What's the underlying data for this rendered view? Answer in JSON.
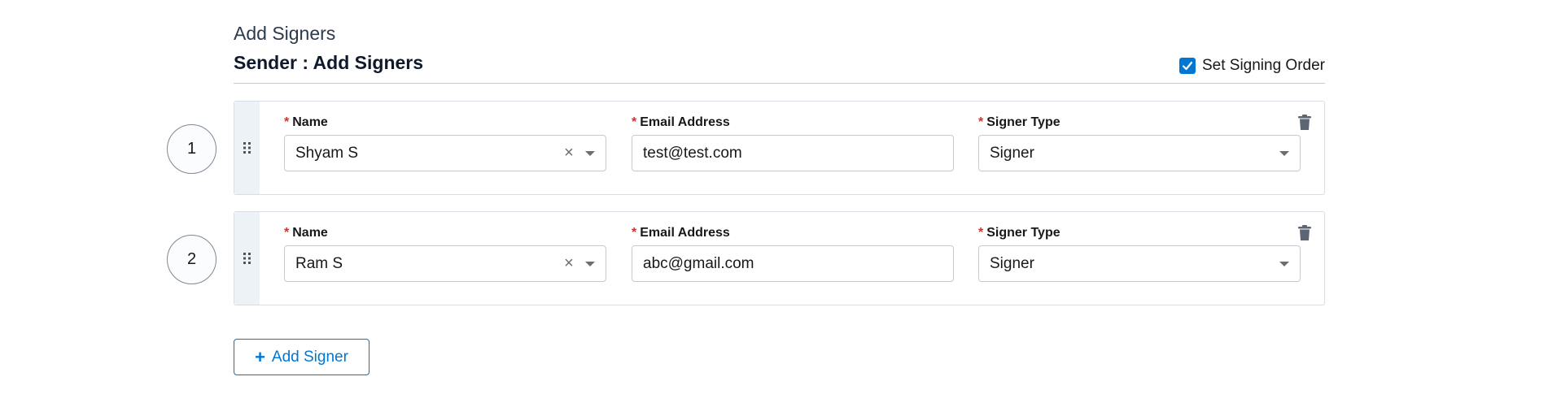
{
  "page": {
    "heading": "Add Signers",
    "section_title": "Sender : Add Signers"
  },
  "signing_order": {
    "label": "Set Signing Order",
    "checked": true
  },
  "labels": {
    "name": "Name",
    "email": "Email Address",
    "signer_type": "Signer Type",
    "required_mark": "*"
  },
  "signers": [
    {
      "order": "1",
      "name": "Shyam S",
      "email": "test@test.com",
      "signer_type": "Signer"
    },
    {
      "order": "2",
      "name": "Ram S",
      "email": "abc@gmail.com",
      "signer_type": "Signer"
    }
  ],
  "icons": {
    "drag": "drag-handle-icon",
    "delete": "trash-icon",
    "clear": "clear-icon",
    "dropdown": "chevron-down-icon",
    "add": "plus-icon",
    "check": "checkmark-icon"
  },
  "add_button": {
    "label": "Add Signer"
  },
  "colors": {
    "accent": "#0176d3",
    "required": "#c23934",
    "border": "#c9c9c9"
  }
}
